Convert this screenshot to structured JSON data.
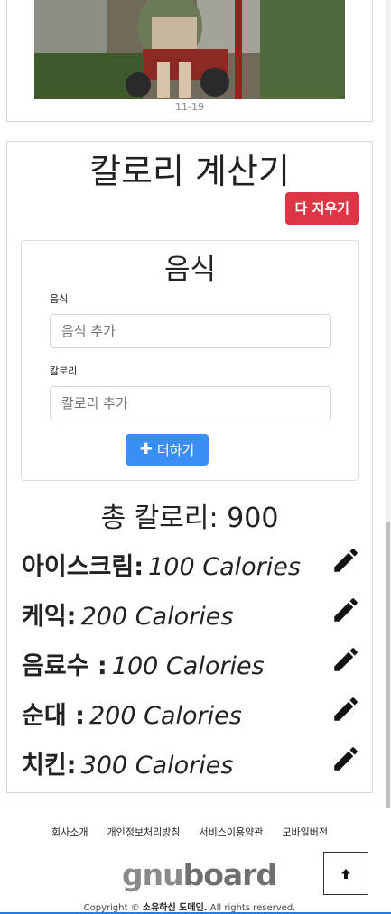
{
  "photo": {
    "caption": "11-19"
  },
  "calculator": {
    "title": "칼로리 계산기",
    "clear_label": "다 지우기",
    "form": {
      "title": "음식",
      "food_label": "음식",
      "food_placeholder": "음식 추가",
      "calorie_label": "칼로리",
      "calorie_placeholder": "칼로리 추가",
      "add_label": "더하기"
    },
    "total_label": "총 칼로리:",
    "total_value": "900",
    "items": [
      {
        "name": "아이스크림:",
        "calories": "100 Calories"
      },
      {
        "name": "케익:",
        "calories": "200 Calories"
      },
      {
        "name": "음료수 :",
        "calories": "100 Calories"
      },
      {
        "name": "순대 :",
        "calories": "200 Calories"
      },
      {
        "name": "치킨:",
        "calories": "300 Calories"
      }
    ]
  },
  "footer": {
    "links": [
      "회사소개",
      "개인정보처리방침",
      "서비스이용약관",
      "모바일버전"
    ],
    "logo_light": "gnu",
    "logo_bold": "board",
    "top_icon": "arrow-up-icon",
    "copyright_prefix": "Copyright ©",
    "copyright_owner": "소유하신 도메인.",
    "copyright_suffix": "All rights reserved."
  }
}
